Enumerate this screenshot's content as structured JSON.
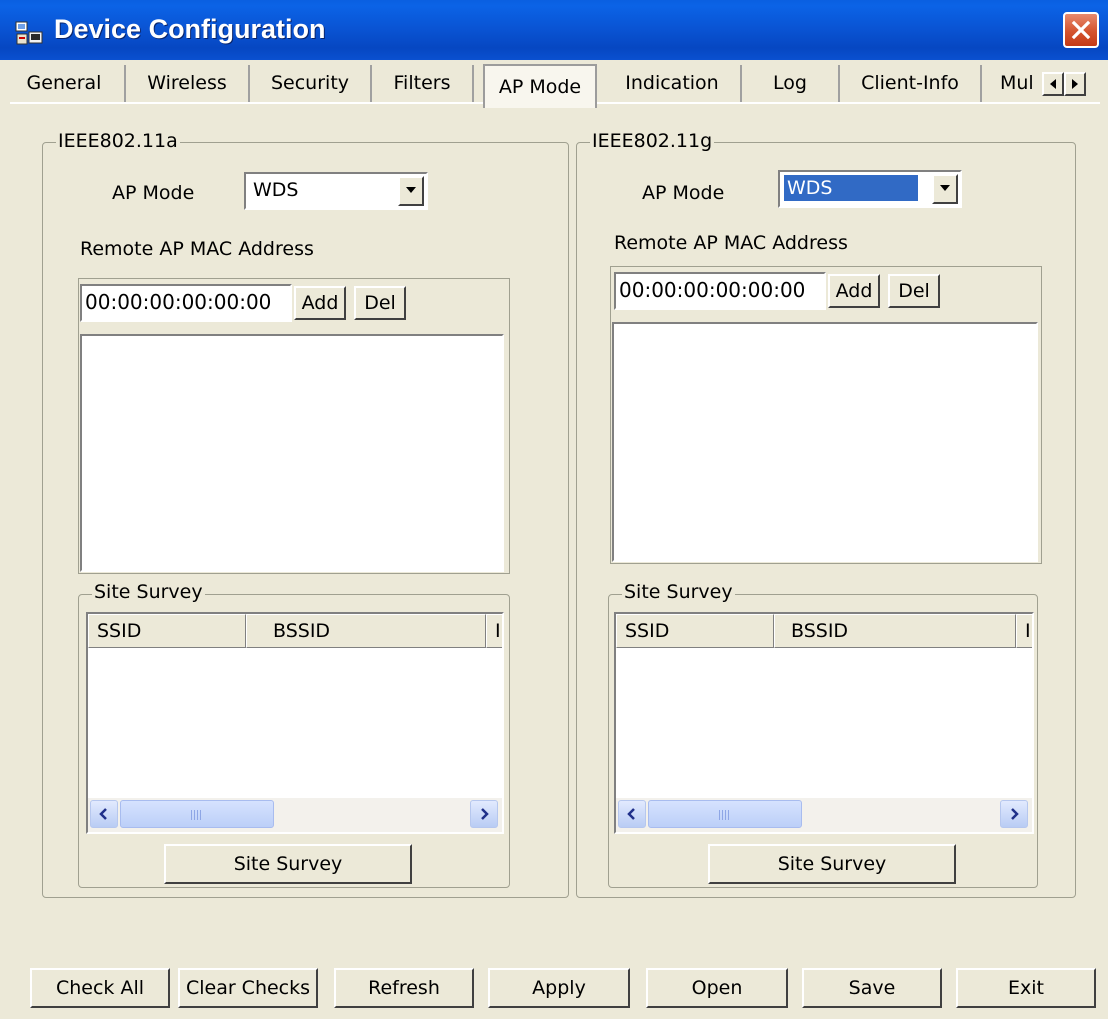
{
  "window": {
    "title": "Device Configuration"
  },
  "tabs": [
    {
      "label": "General"
    },
    {
      "label": "Wireless"
    },
    {
      "label": "Security"
    },
    {
      "label": "Filters"
    },
    {
      "label": "AP Mode",
      "active": true
    },
    {
      "label": "Indication"
    },
    {
      "label": "Log"
    },
    {
      "label": "Client-Info"
    },
    {
      "label": "Mul"
    }
  ],
  "left_panel": {
    "group_label": "IEEE802.11a",
    "ap_mode_label": "AP Mode",
    "ap_mode_value": "WDS",
    "remote_mac_label": "Remote AP MAC Address",
    "mac_value": "00:00:00:00:00:00",
    "add_label": "Add",
    "del_label": "Del",
    "site_survey_group": "Site Survey",
    "columns": [
      "SSID",
      "BSSID",
      "I"
    ],
    "site_survey_button": "Site  Survey"
  },
  "right_panel": {
    "group_label": "IEEE802.11g",
    "ap_mode_label": "AP Mode",
    "ap_mode_value": "WDS",
    "remote_mac_label": "Remote AP MAC Address",
    "mac_value": "00:00:00:00:00:00",
    "add_label": "Add",
    "del_label": "Del",
    "site_survey_group": "Site Survey",
    "columns": [
      "SSID",
      "BSSID",
      "I"
    ],
    "site_survey_button": "Site  Survey"
  },
  "bottom_buttons": {
    "check_all": "Check All",
    "clear_checks": "Clear Checks",
    "refresh": "Refresh",
    "apply": "Apply",
    "open": "Open",
    "save": "Save",
    "exit": "Exit"
  },
  "colors": {
    "titlebar": "#0A55D5",
    "dialog_bg": "#ECE9D8",
    "selection": "#316AC5",
    "close_button": "#D4532E"
  }
}
